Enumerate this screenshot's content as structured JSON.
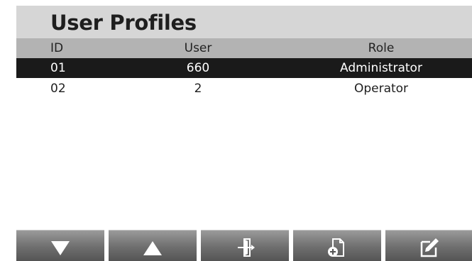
{
  "header": {
    "title": "User Profiles"
  },
  "table": {
    "columns": [
      "ID",
      "User",
      "Role"
    ],
    "rows": [
      {
        "id": "01",
        "user": "660",
        "role": "Administrator",
        "selected": true
      },
      {
        "id": "02",
        "user": "2",
        "role": "Operator",
        "selected": false
      }
    ]
  },
  "softkeys": [
    {
      "icon": "arrow-down-icon"
    },
    {
      "icon": "arrow-up-icon"
    },
    {
      "icon": "exit-icon"
    },
    {
      "icon": "add-document-icon"
    },
    {
      "icon": "edit-icon"
    }
  ],
  "colors": {
    "title_bar": "#d6d6d6",
    "header_bar": "#b3b3b3",
    "selected_row": "#1a1a1a",
    "softkey": "#6f6f6f"
  }
}
